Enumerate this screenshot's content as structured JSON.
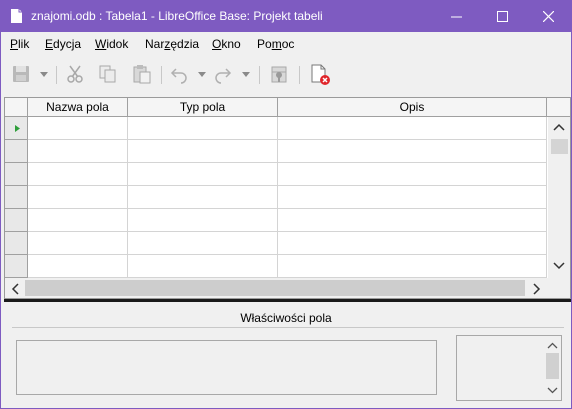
{
  "window": {
    "title": "znajomi.odb : Tabela1 - LibreOffice Base: Projekt tabeli",
    "controls": [
      "minimize-icon",
      "maximize-icon",
      "close-icon"
    ]
  },
  "menubar": {
    "items": [
      {
        "label": "Plik"
      },
      {
        "label": "Edycja"
      },
      {
        "label": "Widok"
      },
      {
        "label": "Narzędzia"
      },
      {
        "label": "Okno"
      },
      {
        "label": "Pomoc"
      }
    ]
  },
  "toolbar": {
    "icons": [
      "save-icon",
      "save-dropdown-icon",
      "cut-icon",
      "copy-icon",
      "paste-icon",
      "undo-icon",
      "undo-dropdown-icon",
      "redo-icon",
      "redo-dropdown-icon",
      "primary-key-icon",
      "index-design-icon"
    ]
  },
  "grid": {
    "columns": [
      {
        "label": "Nazwa pola"
      },
      {
        "label": "Typ pola"
      },
      {
        "label": "Opis"
      }
    ],
    "visible_rows": 7,
    "current_row_marker": "row-pointer-icon"
  },
  "properties": {
    "title": "Właściwości pola"
  },
  "colors": {
    "titlebar": "#7e5bc1",
    "background": "#f0f0f0",
    "row_pointer": "#2e9e3a",
    "error_badge": "#e0262b"
  }
}
